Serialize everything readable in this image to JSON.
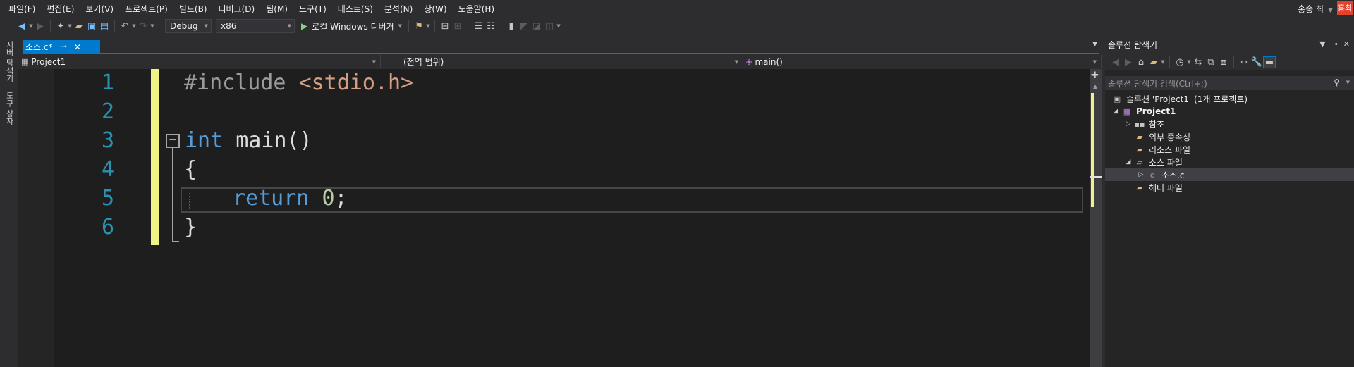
{
  "menu": {
    "items": [
      "파일(F)",
      "편집(E)",
      "보기(V)",
      "프로젝트(P)",
      "빌드(B)",
      "디버그(D)",
      "팀(M)",
      "도구(T)",
      "테스트(S)",
      "분석(N)",
      "창(W)",
      "도움말(H)"
    ],
    "user_name": "홍송 최",
    "avatar_text": "홍최"
  },
  "toolbar": {
    "configuration": "Debug",
    "platform": "x86",
    "run_label": "로컬 Windows 디버거"
  },
  "left_strip": {
    "server_explorer": "서버 탐색기",
    "toolbox": "도구 상자"
  },
  "doc_tab": {
    "title": "소스.c*",
    "pin": "⊸",
    "close": "✕"
  },
  "navbar": {
    "project": "Project1",
    "scope": "(전역 범위)",
    "member": "main()"
  },
  "editor": {
    "line_numbers": [
      "1",
      "2",
      "3",
      "4",
      "5",
      "6"
    ],
    "code": {
      "l1_directive": "#include",
      "l1_header": "<stdio.h>",
      "l3_type": "int",
      "l3_name": " main()",
      "l4": "{",
      "l5_kw": "return",
      "l5_num": "0",
      "l5_semi": ";",
      "l6": "}"
    },
    "fold_symbol": "−"
  },
  "solution_explorer": {
    "title": "솔루션 탐색기",
    "search_placeholder": "솔루션 탐색기 검색(Ctrl+;)",
    "tree": {
      "solution": "솔루션 'Project1' (1개 프로젝트)",
      "project": "Project1",
      "references": "참조",
      "external_deps": "외부 종속성",
      "resource_files": "리소스 파일",
      "source_files": "소스 파일",
      "source_c": "소스.c",
      "header_files": "헤더 파일"
    }
  },
  "colors": {
    "accent": "#007acc",
    "editor_bg": "#1e1e1e",
    "keyword": "#569cd6",
    "string": "#d69d85",
    "number": "#b5cea8",
    "line_number": "#2b91af",
    "change_marker": "#eff284"
  }
}
